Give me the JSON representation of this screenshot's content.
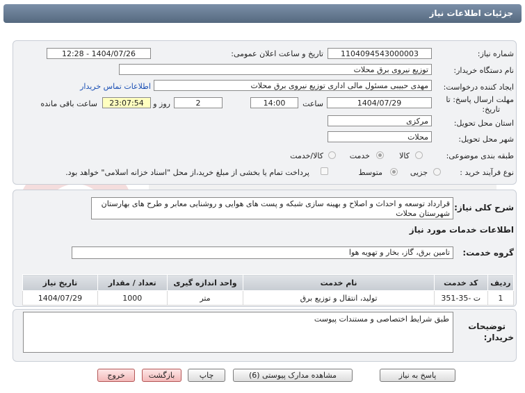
{
  "header": {
    "title": "جزئیات اطلاعات نیاز"
  },
  "form": {
    "need_number_label": "شماره نیاز:",
    "need_number": "1104094543000003",
    "announce_label": "تاریخ و ساعت اعلان عمومی:",
    "announce_value": "1404/07/26 - 12:28",
    "buyer_org_label": "نام دستگاه خریدار:",
    "buyer_org": "توزیع نیروی برق محلات",
    "requester_label": "ایجاد کننده درخواست:",
    "requester": "مهدی  حبیبی مسئول مالی اداری توزیع نیروی برق محلات",
    "contact_link": "اطلاعات تماس خریدار",
    "deadline_label_1": "مهلت ارسال پاسخ: تا",
    "deadline_label_2": "تاریخ:",
    "deadline_date": "1404/07/29",
    "time_label": "ساعت",
    "deadline_time": "14:00",
    "days_value": "2",
    "days_label": "روز و",
    "remaining_value": "23:07:54",
    "remaining_label": "ساعت باقی مانده",
    "province_label": "استان محل تحویل:",
    "province": "مرکزی",
    "city_label": "شهر محل تحویل:",
    "city": "محلات",
    "category_label": "طبقه بندی موضوعی:",
    "category_options": [
      "کالا",
      "خدمت",
      "کالا/خدمت"
    ],
    "process_label": "نوع فرآیند خرید :",
    "process_options": [
      "جزیی",
      "متوسط"
    ],
    "payment_note": "پرداخت تمام یا بخشی از مبلغ خرید،از محل \"اسناد خزانه اسلامی\" خواهد بود."
  },
  "summary": {
    "label": "شرح کلی نیاز:",
    "text": "قرارداد توسعه و احداث و اصلاح و بهینه سازی شبکه و پست های هوایی و روشنایی معابر و طرح های بهارستان شهرستان محلات"
  },
  "services": {
    "section_title": "اطلاعات خدمات مورد نیاز",
    "group_label": "گروه خدمت:",
    "group_value": "تامین برق، گاز، بخار و تهویه هوا",
    "columns": [
      "ردیف",
      "کد خدمت",
      "نام خدمت",
      "واحد اندازه گیری",
      "تعداد / مقدار",
      "تاریخ نیاز"
    ],
    "rows": [
      {
        "row": "1",
        "code": "ت -35-351",
        "name": "تولید، انتقال و توزیع برق",
        "unit": "متر",
        "qty": "1000",
        "date": "1404/07/29"
      }
    ]
  },
  "notes": {
    "label_1": "توضیحات",
    "label_2": "خریدار:",
    "text": "طبق شرایط اختصاصی و مستندات پیوست"
  },
  "buttons": {
    "reply": "پاسخ به نیاز",
    "docs": "مشاهده مدارک پیوستی (6)",
    "print": "چاپ",
    "back": "بازگشت",
    "exit": "خروج"
  },
  "colors": {
    "header_bg": "#5f738a",
    "panel_bg": "#f1f2f4",
    "link": "#1a4fb4",
    "remaining_bg": "#ffffc0"
  }
}
